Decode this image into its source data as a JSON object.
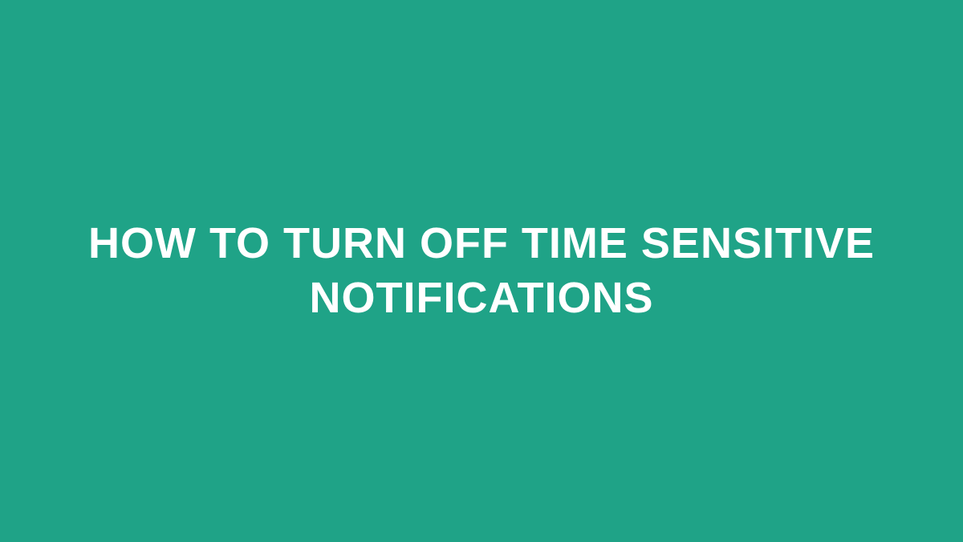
{
  "title": "HOW TO TURN OFF TIME SENSITIVE NOTIFICATIONS",
  "colors": {
    "background": "#1fa387",
    "text": "#ffffff"
  }
}
